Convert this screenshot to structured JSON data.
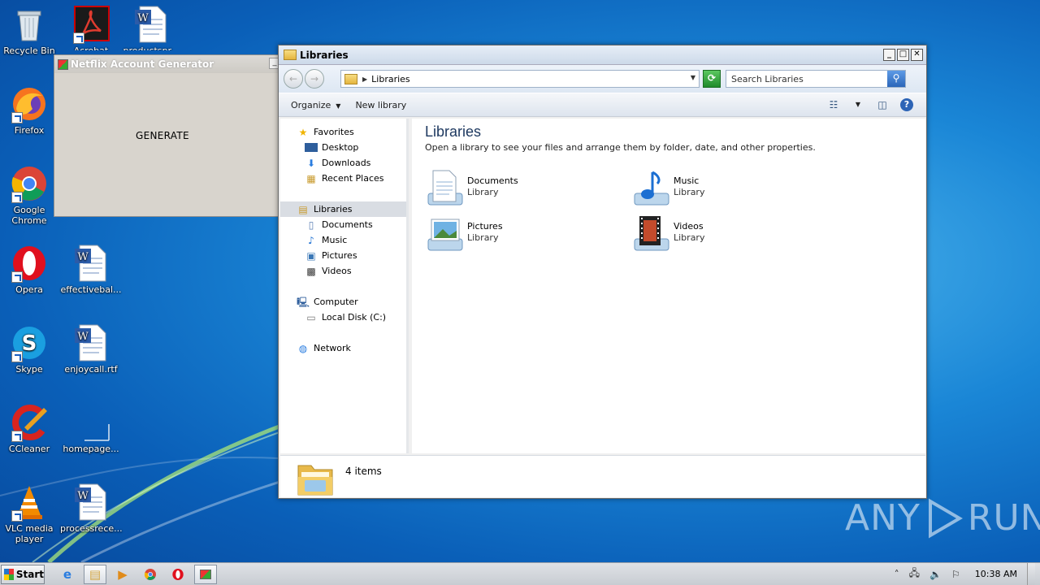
{
  "desktop": {
    "icons": [
      {
        "label": "Recycle Bin",
        "icon": "recycle-bin-icon"
      },
      {
        "label": "Acrobat",
        "icon": "acrobat-icon"
      },
      {
        "label": "productspr...",
        "icon": "word-doc-icon"
      },
      {
        "label": "Firefox",
        "icon": "firefox-icon"
      },
      {
        "label": "Google Chrome",
        "icon": "chrome-icon"
      },
      {
        "label": "Opera",
        "icon": "opera-icon"
      },
      {
        "label": "effectivebal...",
        "icon": "word-doc-icon"
      },
      {
        "label": "Skype",
        "icon": "skype-icon"
      },
      {
        "label": "enjoycall.rtf",
        "icon": "word-doc-icon"
      },
      {
        "label": "CCleaner",
        "icon": "ccleaner-icon"
      },
      {
        "label": "homepage...",
        "icon": "blank-file-icon"
      },
      {
        "label": "VLC media player",
        "icon": "vlc-icon"
      },
      {
        "label": "processrece...",
        "icon": "word-doc-icon"
      }
    ]
  },
  "generator_window": {
    "title": "Netflix Account Generator",
    "button_label": "GENERATE",
    "minimize_glyph": "_"
  },
  "explorer": {
    "title": "Libraries",
    "window_buttons": {
      "minimize": "_",
      "maximize": "□",
      "close": "✕"
    },
    "address": {
      "back": "←",
      "forward": "→",
      "path": "Libraries"
    },
    "search": {
      "placeholder": "Search Libraries"
    },
    "toolbar": {
      "organize": "Organize",
      "new_library": "New library"
    },
    "nav": [
      {
        "label": "Favorites",
        "icon": "star-icon",
        "level": 1
      },
      {
        "label": "Desktop",
        "icon": "desktop-icon",
        "level": 2
      },
      {
        "label": "Downloads",
        "icon": "downloads-icon",
        "level": 2
      },
      {
        "label": "Recent Places",
        "icon": "recent-places-icon",
        "level": 2
      },
      {
        "label": "Libraries",
        "icon": "libraries-icon",
        "level": 1,
        "selected": true
      },
      {
        "label": "Documents",
        "icon": "documents-icon",
        "level": 2
      },
      {
        "label": "Music",
        "icon": "music-icon",
        "level": 2
      },
      {
        "label": "Pictures",
        "icon": "pictures-icon",
        "level": 2
      },
      {
        "label": "Videos",
        "icon": "videos-icon",
        "level": 2
      },
      {
        "label": "Computer",
        "icon": "computer-icon",
        "level": 1
      },
      {
        "label": "Local Disk (C:)",
        "icon": "local-disk-icon",
        "level": 2
      },
      {
        "label": "Network",
        "icon": "network-icon",
        "level": 1
      }
    ],
    "heading": "Libraries",
    "description": "Open a library to see your files and arrange them by folder, date, and other properties.",
    "libraries": [
      {
        "name": "Documents",
        "type": "Library",
        "icon": "documents-library-icon"
      },
      {
        "name": "Music",
        "type": "Library",
        "icon": "music-library-icon"
      },
      {
        "name": "Pictures",
        "type": "Library",
        "icon": "pictures-library-icon"
      },
      {
        "name": "Videos",
        "type": "Library",
        "icon": "videos-library-icon"
      }
    ],
    "status": {
      "count": "4 items"
    }
  },
  "watermark": {
    "left": "ANY",
    "right": "RUN"
  },
  "taskbar": {
    "start_label": "Start",
    "pinned": [
      "internet-explorer-icon",
      "explorer-icon",
      "media-player-icon",
      "chrome-icon",
      "opera-icon",
      "generator-app-icon"
    ],
    "clock": "10:38 AM"
  },
  "colors": {
    "accent": "#1e3960",
    "selection": "#d9dde3",
    "wallpaper": "#1a86d6"
  }
}
